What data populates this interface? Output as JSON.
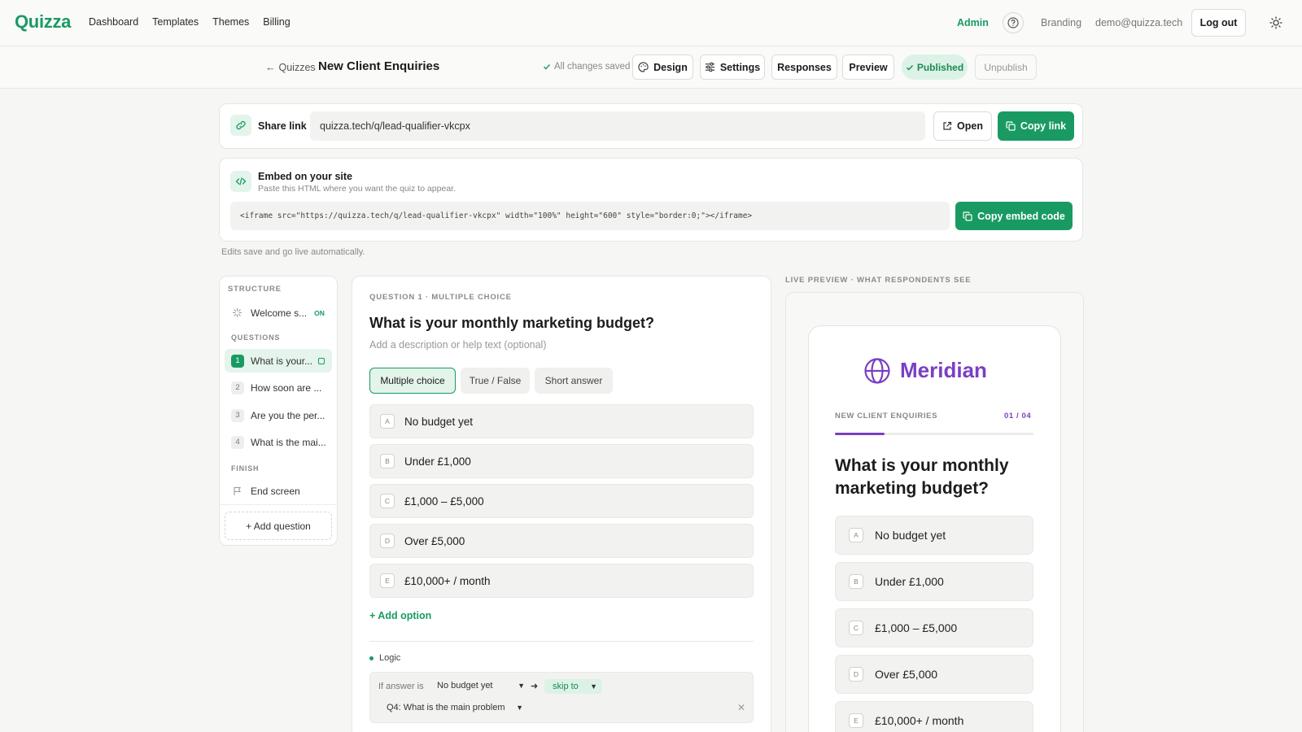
{
  "app": {
    "logo": "Quizza"
  },
  "nav": {
    "items": [
      "Dashboard",
      "Templates",
      "Themes",
      "Billing"
    ],
    "admin": "Admin",
    "branding": "Branding",
    "email": "demo@quizza.tech",
    "logout": "Log out"
  },
  "subheader": {
    "back": "Quizzes",
    "title": "New Client Enquiries",
    "saved": "All changes saved",
    "design": "Design",
    "settings": "Settings",
    "responses": "Responses",
    "preview": "Preview",
    "published": "Published",
    "unpublish": "Unpublish"
  },
  "share": {
    "label": "Share link",
    "url": "quizza.tech/q/lead-qualifier-vkcpx",
    "open": "Open",
    "copy": "Copy link"
  },
  "embed": {
    "title": "Embed on your site",
    "subtitle": "Paste this HTML where you want the quiz to appear.",
    "code": "<iframe src=\"https://quizza.tech/q/lead-qualifier-vkcpx\" width=\"100%\" height=\"600\" style=\"border:0;\"></iframe>",
    "copy": "Copy embed code",
    "note": "Edits save and go live automatically."
  },
  "structure": {
    "label": "STRUCTURE",
    "welcome": "Welcome s...",
    "welcome_state": "ON",
    "questions_label": "QUESTIONS",
    "questions": [
      {
        "num": "1",
        "label": "What is your..."
      },
      {
        "num": "2",
        "label": "How soon are ..."
      },
      {
        "num": "3",
        "label": "Are you the per..."
      },
      {
        "num": "4",
        "label": "What is the mai..."
      }
    ],
    "finish_label": "FINISH",
    "end_screen": "End screen",
    "add_question": "+ Add question"
  },
  "editor": {
    "label": "QUESTION 1 · MULTIPLE CHOICE",
    "question": "What is your monthly marketing budget?",
    "description_placeholder": "Add a description or help text (optional)",
    "types": [
      "Multiple choice",
      "True / False",
      "Short answer"
    ],
    "options": [
      {
        "letter": "A",
        "text": "No budget yet"
      },
      {
        "letter": "B",
        "text": "Under £1,000"
      },
      {
        "letter": "C",
        "text": "£1,000 – £5,000"
      },
      {
        "letter": "D",
        "text": "Over £5,000"
      },
      {
        "letter": "E",
        "text": "£10,000+ / month"
      }
    ],
    "add_option": "+ Add option",
    "logic": {
      "label": "Logic",
      "if_answer": "If answer is",
      "answer": "No budget yet",
      "action": "skip to",
      "target": "Q4: What is the main problem"
    }
  },
  "preview": {
    "label": "LIVE PREVIEW · WHAT RESPONDENTS SEE",
    "brand": "Meridian",
    "quiz_name": "NEW CLIENT ENQUIRIES",
    "counter": "01 / 04",
    "progress": 0.25,
    "question": "What is your monthly marketing budget?",
    "options": [
      {
        "letter": "A",
        "text": "No budget yet"
      },
      {
        "letter": "B",
        "text": "Under £1,000"
      },
      {
        "letter": "C",
        "text": "£1,000 – £5,000"
      },
      {
        "letter": "D",
        "text": "Over £5,000"
      },
      {
        "letter": "E",
        "text": "£10,000+ / month"
      }
    ]
  },
  "colors": {
    "accent": "#1a9a63",
    "brand": "#7a3fc2"
  }
}
